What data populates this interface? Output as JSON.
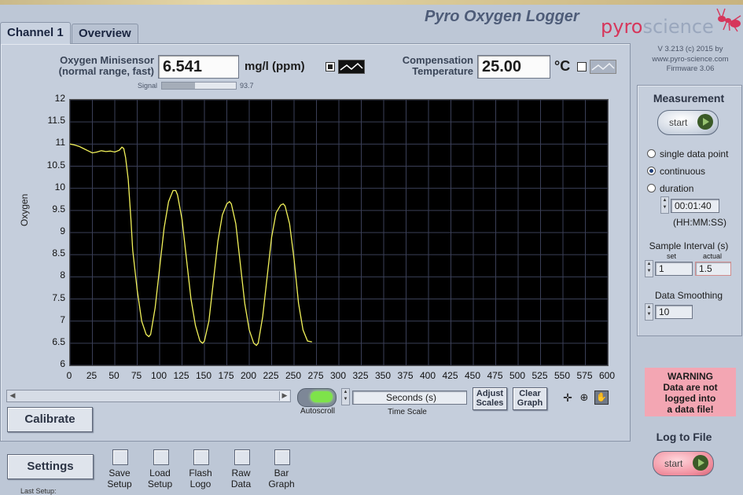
{
  "app": {
    "title": "Pyro Oxygen Logger",
    "logo_part1": "pyro",
    "logo_part2": "science",
    "version_line1": "V 3.213 (c) 2015 by",
    "version_line2": "www.pyro-science.com",
    "version_line3": "Firmware  3.06"
  },
  "tabs": [
    {
      "label": "Channel 1"
    },
    {
      "label": "Overview"
    }
  ],
  "sensor": {
    "label_line1": "Oxygen Minisensor",
    "label_line2": "(normal range, fast)",
    "value": "6.541",
    "unit": "mg/l (ppm)",
    "signal_label": "Signal",
    "signal_value": "93.7",
    "signal_fraction": 0.45
  },
  "compensation": {
    "label_line1": "Compensation",
    "label_line2": "Temperature",
    "value": "25.00",
    "unit": "°C"
  },
  "chart_data": {
    "type": "line",
    "ylabel": "Oxygen",
    "xlabel": "",
    "xlim": [
      0,
      600
    ],
    "ylim": [
      6,
      12
    ],
    "x_ticks": [
      "0",
      "25",
      "50",
      "75",
      "100",
      "125",
      "150",
      "175",
      "200",
      "225",
      "250",
      "275",
      "300",
      "325",
      "350",
      "375",
      "400",
      "425",
      "450",
      "475",
      "500",
      "525",
      "550",
      "575",
      "600"
    ],
    "y_ticks": [
      "12",
      "11.5",
      "11",
      "10.5",
      "10",
      "9.5",
      "9",
      "8.5",
      "8",
      "7.5",
      "7",
      "6.5",
      "6"
    ],
    "series": [
      {
        "color": "#f2f25a",
        "x": [
          0,
          5,
          10,
          15,
          20,
          25,
          30,
          35,
          40,
          45,
          50,
          55,
          58,
          60,
          62,
          65,
          68,
          70,
          75,
          80,
          85,
          88,
          90,
          95,
          100,
          105,
          110,
          115,
          118,
          120,
          125,
          130,
          135,
          140,
          145,
          148,
          150,
          155,
          160,
          165,
          170,
          175,
          178,
          180,
          185,
          190,
          195,
          200,
          205,
          208,
          210,
          215,
          220,
          225,
          230,
          235,
          238,
          240,
          245,
          250,
          255,
          260,
          265,
          270
        ],
        "y": [
          11.0,
          10.98,
          10.95,
          10.9,
          10.85,
          10.8,
          10.82,
          10.85,
          10.83,
          10.84,
          10.82,
          10.86,
          10.93,
          10.9,
          10.7,
          10.2,
          9.3,
          8.6,
          7.7,
          7.0,
          6.7,
          6.65,
          6.7,
          7.3,
          8.2,
          9.1,
          9.7,
          9.95,
          9.95,
          9.85,
          9.3,
          8.4,
          7.5,
          6.9,
          6.55,
          6.5,
          6.55,
          7.0,
          7.9,
          8.8,
          9.4,
          9.65,
          9.7,
          9.65,
          9.2,
          8.3,
          7.4,
          6.8,
          6.5,
          6.45,
          6.5,
          7.1,
          8.0,
          8.9,
          9.45,
          9.62,
          9.65,
          9.6,
          9.2,
          8.4,
          7.4,
          6.8,
          6.55,
          6.53
        ]
      }
    ]
  },
  "controls": {
    "autoscroll_label": "Autoscroll",
    "time_scale_value": "Seconds (s)",
    "time_scale_label": "Time Scale",
    "adjust_scales_l1": "Adjust",
    "adjust_scales_l2": "Scales",
    "clear_graph_l1": "Clear",
    "clear_graph_l2": "Graph",
    "calibrate_label": "Calibrate"
  },
  "measurement": {
    "title": "Measurement",
    "start_label": "start",
    "opt_single": "single data point",
    "opt_continuous": "continuous",
    "opt_duration": "duration",
    "duration_value": "00:01:40",
    "duration_format": "(HH:MM:SS)",
    "interval_title": "Sample Interval (s)",
    "set_label": "set",
    "actual_label": "actual",
    "set_value": "1",
    "actual_value": "1.5",
    "smoothing_title": "Data Smoothing",
    "smoothing_value": "10"
  },
  "warning": {
    "line1": "WARNING",
    "line2": "Data are not",
    "line3": "logged into",
    "line4": "a data file!"
  },
  "log": {
    "title": "Log to File",
    "start_label": "start"
  },
  "bottom": {
    "settings_label": "Settings",
    "items": [
      {
        "l1": "Save",
        "l2": "Setup"
      },
      {
        "l1": "Load",
        "l2": "Setup"
      },
      {
        "l1": "Flash",
        "l2": "Logo"
      },
      {
        "l1": "Raw",
        "l2": "Data"
      },
      {
        "l1": "Bar",
        "l2": "Graph"
      }
    ],
    "last_setup": "Last Setup:"
  }
}
